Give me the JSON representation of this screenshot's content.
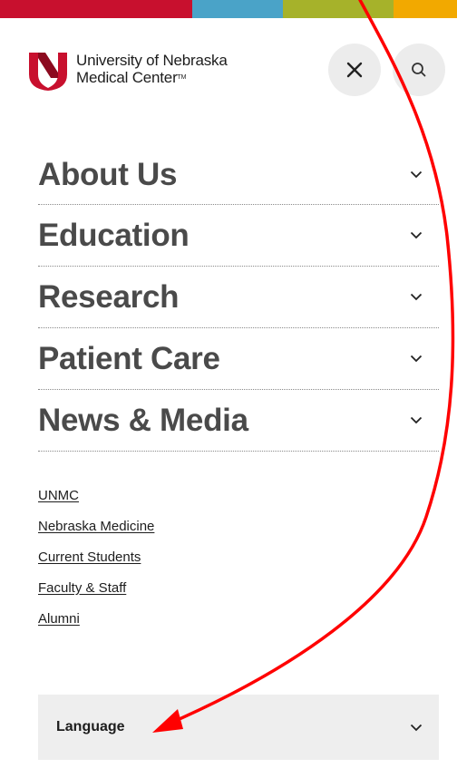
{
  "header": {
    "logo_line1": "University of Nebraska",
    "logo_line2": "Medical Center",
    "logo_mark": "TM",
    "close_icon": "close-icon",
    "search_icon": "search-icon",
    "brand_color": "#c8102e"
  },
  "top_bar_colors": [
    "#c8102e",
    "#4aa3c8",
    "#a6b22a",
    "#f2a900"
  ],
  "main_nav": {
    "items": [
      {
        "label": "About Us"
      },
      {
        "label": "Education"
      },
      {
        "label": "Research"
      },
      {
        "label": "Patient Care"
      },
      {
        "label": "News & Media"
      }
    ],
    "expand_icon": "chevron-down-icon"
  },
  "quick_links": [
    {
      "label": "UNMC"
    },
    {
      "label": "Nebraska Medicine"
    },
    {
      "label": "Current Students"
    },
    {
      "label": "Faculty & Staff"
    },
    {
      "label": "Alumni"
    }
  ],
  "language": {
    "label": "Language",
    "expand_icon": "chevron-down-icon"
  },
  "annotation": {
    "type": "red-arrow",
    "color": "#ff0000"
  }
}
